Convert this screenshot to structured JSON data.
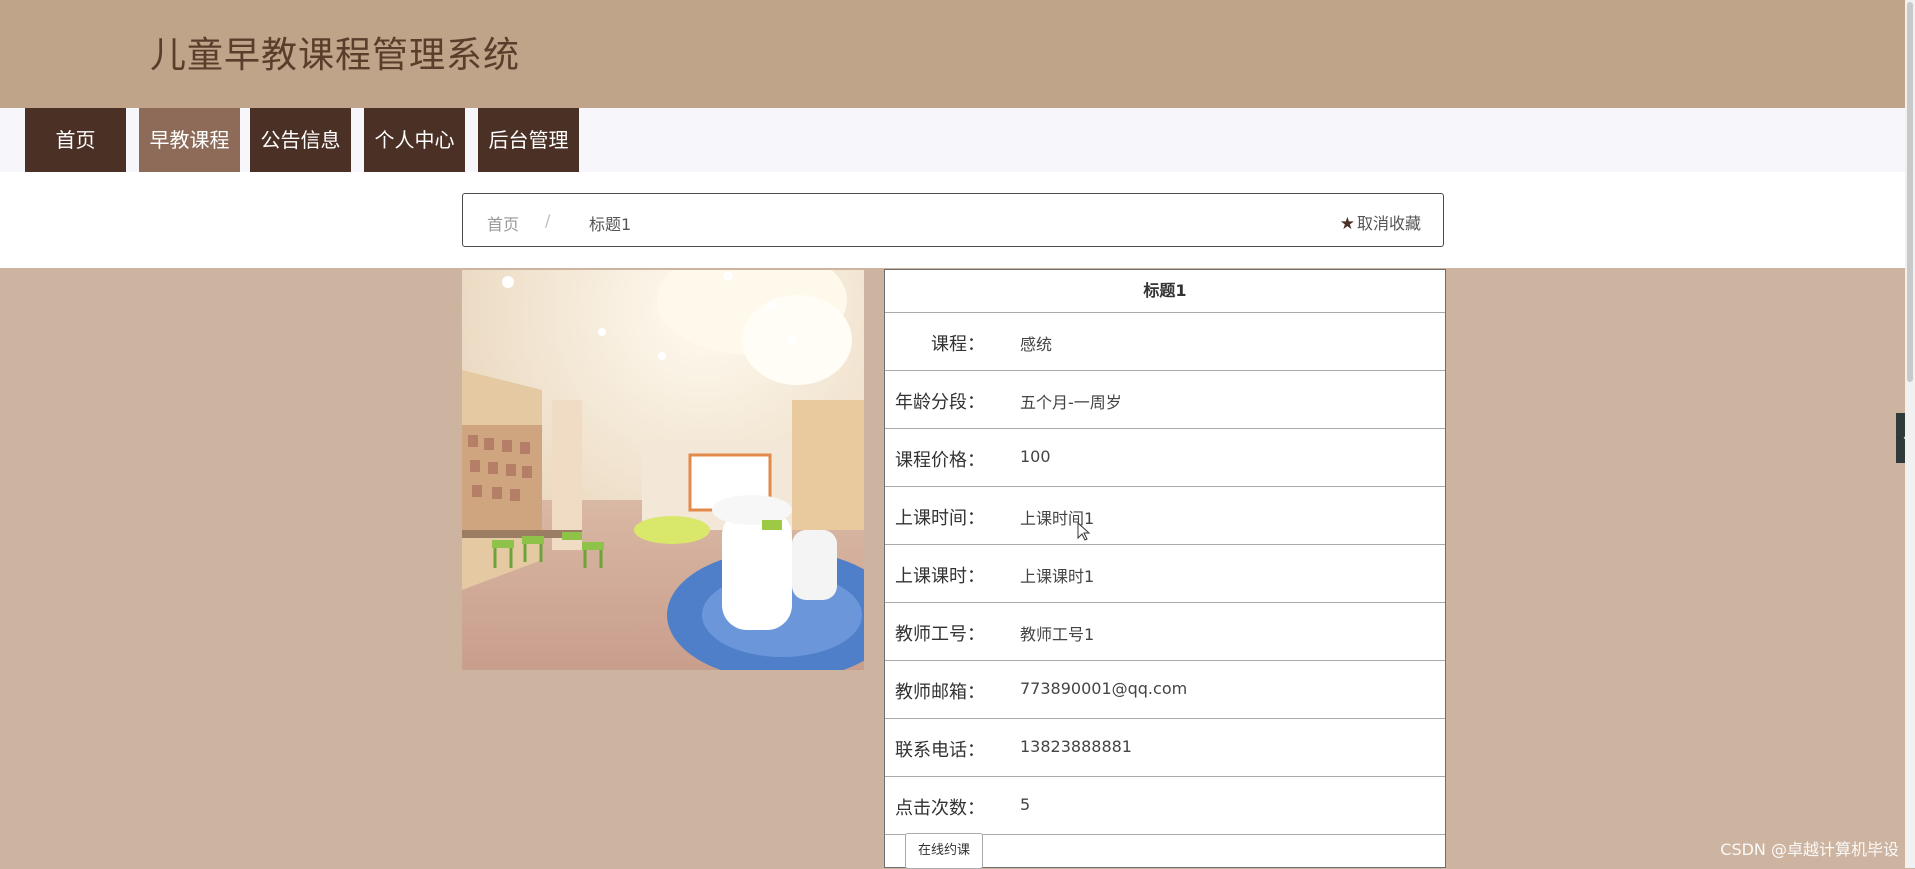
{
  "header": {
    "title": "儿童早教课程管理系统"
  },
  "nav": {
    "items": [
      {
        "label": "首页"
      },
      {
        "label": "早教课程"
      },
      {
        "label": "公告信息"
      },
      {
        "label": "个人中心"
      },
      {
        "label": "后台管理"
      }
    ],
    "active_index": 1
  },
  "breadcrumb": {
    "home": "首页",
    "separator": "/",
    "current": "标题1"
  },
  "favorite": {
    "label": "取消收藏",
    "icon": "star-icon"
  },
  "detail": {
    "title": "标题1",
    "fields": [
      {
        "label": "课程：",
        "value": "感统"
      },
      {
        "label": "年龄分段：",
        "value": "五个月-一周岁"
      },
      {
        "label": "课程价格：",
        "value": "100"
      },
      {
        "label": "上课时间：",
        "value": "上课时间1"
      },
      {
        "label": "上课课时：",
        "value": "上课课时1"
      },
      {
        "label": "教师工号：",
        "value": "教师工号1"
      },
      {
        "label": "教师邮箱：",
        "value": "773890001@qq.com"
      },
      {
        "label": "联系电话：",
        "value": "13823888881"
      },
      {
        "label": "点击次数：",
        "value": "5"
      }
    ],
    "button": "在线约课"
  },
  "watermark": "CSDN @卓越计算机毕设",
  "colors": {
    "header_bg": "#c0a489",
    "nav_bg": "#4b3026",
    "nav_active_bg": "#8d6b58",
    "page_bg": "#cdb4a0"
  }
}
